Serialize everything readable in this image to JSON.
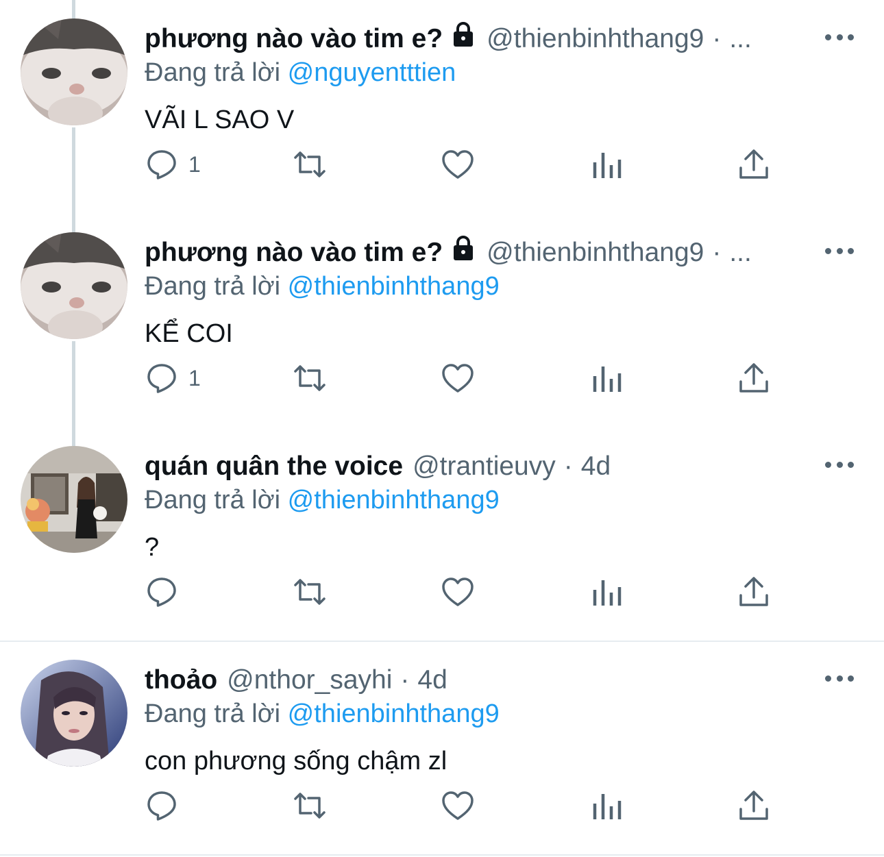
{
  "tweets": [
    {
      "name": "phương nào vào tim e?",
      "locked": true,
      "handle": "@thienbinhthang9",
      "separator": "·",
      "time": "...",
      "reply_prefix": "Đang trả lời",
      "reply_to": "@nguyentttien",
      "text": "VÃI L SAO V",
      "reply_count": "1",
      "avatar": "cat-photo"
    },
    {
      "name": "phương nào vào tim e?",
      "locked": true,
      "handle": "@thienbinhthang9",
      "separator": "·",
      "time": "...",
      "reply_prefix": "Đang trả lời",
      "reply_to": "@thienbinhthang9",
      "text": "KỂ COI",
      "reply_count": "1",
      "avatar": "cat-photo"
    },
    {
      "name": "quán quân the voice",
      "locked": false,
      "handle": "@trantieuvy",
      "separator": "·",
      "time": "4d",
      "reply_prefix": "Đang trả lời",
      "reply_to": "@thienbinhthang9",
      "text": "?",
      "reply_count": "",
      "avatar": "woman-with-dog-photo"
    },
    {
      "name": "thoảo",
      "locked": false,
      "handle": "@nthor_sayhi",
      "separator": "·",
      "time": "4d",
      "reply_prefix": "Đang trả lời",
      "reply_to": "@thienbinhthang9",
      "text": "con phương sống chậm zl",
      "reply_count": "",
      "avatar": "woman-portrait-photo"
    }
  ],
  "icons": {
    "reply": "reply-bubble-icon",
    "retweet": "retweet-icon",
    "like": "heart-icon",
    "views": "views-bar-chart-icon",
    "share": "share-upload-icon",
    "more": "more-dots-icon",
    "lock": "lock-icon"
  },
  "colors": {
    "text": "#0f1419",
    "muted": "#536471",
    "link": "#1d9bf0",
    "thread_line": "#cfd9de",
    "divider": "#e6ecf0"
  }
}
